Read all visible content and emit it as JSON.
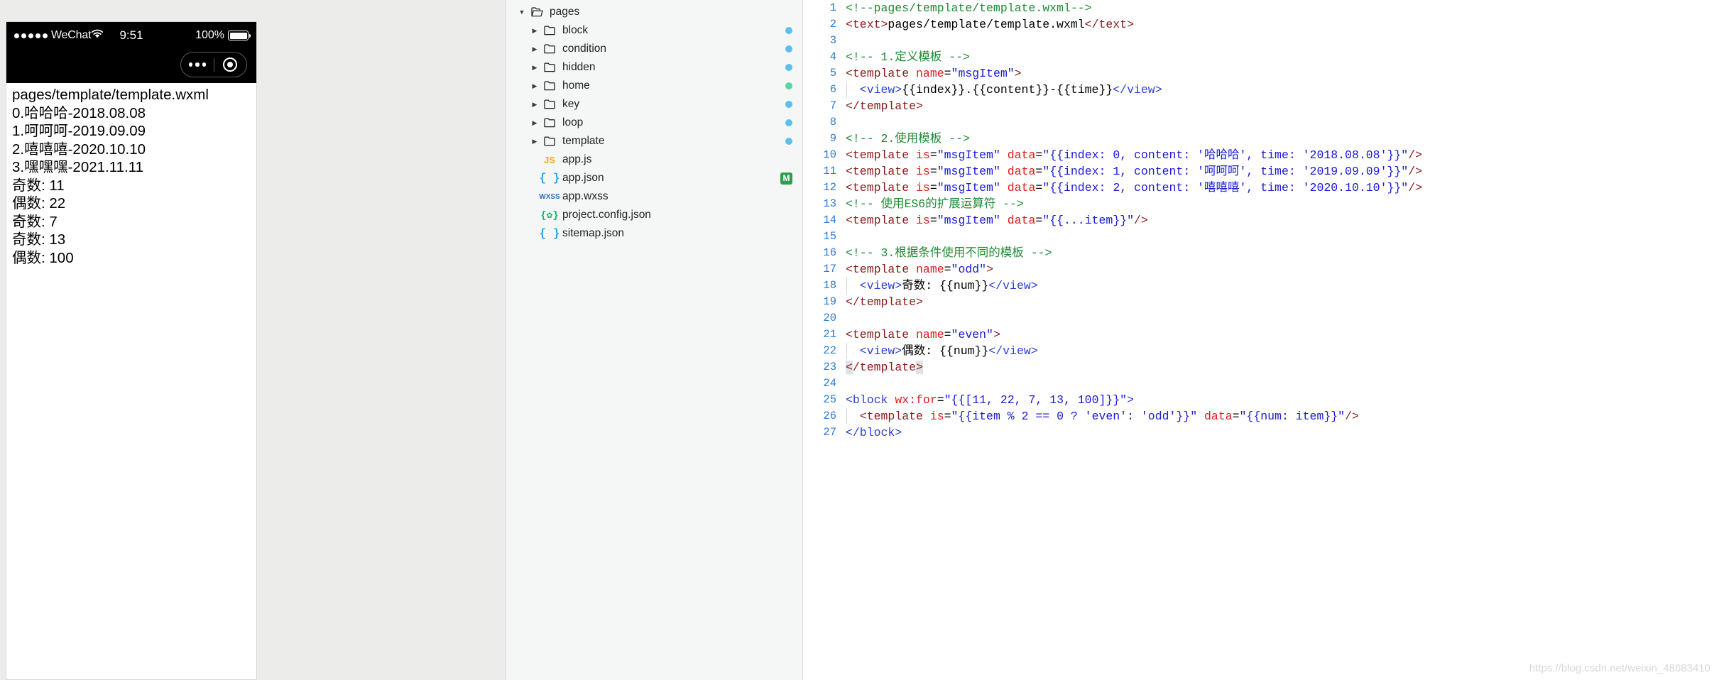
{
  "simulator": {
    "status_bar": {
      "signal_dots": 5,
      "carrier": "WeChat",
      "wifi_icon": "wifi-icon",
      "time": "9:51",
      "battery_percent": "100%",
      "battery_icon": "battery-full-icon"
    },
    "nav_capsule": {
      "menu_icon": "more-dots-icon",
      "target_icon": "target-circle-icon"
    },
    "page_lines": [
      "pages/template/template.wxml",
      "0.哈哈哈-2018.08.08",
      "1.呵呵呵-2019.09.09",
      "2.嘻嘻嘻-2020.10.10",
      "3.嘿嘿嘿-2021.11.11",
      "奇数: 11",
      "偶数: 22",
      "奇数: 7",
      "奇数: 13",
      "偶数: 100"
    ]
  },
  "file_tree": {
    "items": [
      {
        "label": "pages",
        "type": "folder",
        "depth": 0,
        "expanded": true,
        "arrow": "▼",
        "icon": "folder-open-icon",
        "dot": null,
        "badge": null
      },
      {
        "label": "block",
        "type": "folder",
        "depth": 1,
        "expanded": false,
        "arrow": "▶",
        "icon": "folder-icon",
        "dot": "#5bc0f0",
        "badge": null
      },
      {
        "label": "condition",
        "type": "folder",
        "depth": 1,
        "expanded": false,
        "arrow": "▶",
        "icon": "folder-icon",
        "dot": "#5bc0f0",
        "badge": null
      },
      {
        "label": "hidden",
        "type": "folder",
        "depth": 1,
        "expanded": false,
        "arrow": "▶",
        "icon": "folder-icon",
        "dot": "#5bc0f0",
        "badge": null
      },
      {
        "label": "home",
        "type": "folder",
        "depth": 1,
        "expanded": false,
        "arrow": "▶",
        "icon": "folder-icon",
        "dot": "#57d6a0",
        "badge": null
      },
      {
        "label": "key",
        "type": "folder",
        "depth": 1,
        "expanded": false,
        "arrow": "▶",
        "icon": "folder-icon",
        "dot": "#5bc0f0",
        "badge": null
      },
      {
        "label": "loop",
        "type": "folder",
        "depth": 1,
        "expanded": false,
        "arrow": "▶",
        "icon": "folder-icon",
        "dot": "#5bc0f0",
        "badge": null
      },
      {
        "label": "template",
        "type": "folder",
        "depth": 1,
        "expanded": false,
        "arrow": "▶",
        "icon": "folder-icon",
        "dot": "#5bc0f0",
        "badge": null
      },
      {
        "label": "app.js",
        "type": "file",
        "depth": 1,
        "expanded": null,
        "arrow": "",
        "icon": "js-file-icon",
        "dot": null,
        "badge": null,
        "ext_label": "JS",
        "ext_class": "ext-js"
      },
      {
        "label": "app.json",
        "type": "file",
        "depth": 1,
        "expanded": null,
        "arrow": "",
        "icon": "json-file-icon",
        "dot": null,
        "badge": "M",
        "ext_label": "{ }",
        "ext_class": "ext-json"
      },
      {
        "label": "app.wxss",
        "type": "file",
        "depth": 1,
        "expanded": null,
        "arrow": "",
        "icon": "wxss-file-icon",
        "dot": null,
        "badge": null,
        "ext_label": "WXSS",
        "ext_class": "ext-wxss"
      },
      {
        "label": "project.config.json",
        "type": "file",
        "depth": 1,
        "expanded": null,
        "arrow": "",
        "icon": "config-file-icon",
        "dot": null,
        "badge": null,
        "ext_label": "{✿}",
        "ext_class": "ext-cfg"
      },
      {
        "label": "sitemap.json",
        "type": "file",
        "depth": 1,
        "expanded": null,
        "arrow": "",
        "icon": "json-file-icon",
        "dot": null,
        "badge": null,
        "ext_label": "{ }",
        "ext_class": "ext-json"
      }
    ]
  },
  "editor": {
    "language": "wxml",
    "first_line_number": 1,
    "lines": [
      {
        "n": 1,
        "indent": false,
        "tokens": [
          {
            "t": "<!--pages/template/template.wxml-->",
            "c": "c-comment"
          }
        ]
      },
      {
        "n": 2,
        "indent": false,
        "tokens": [
          {
            "t": "<text>",
            "c": "c-tag"
          },
          {
            "t": "pages/template/template.wxml",
            "c": "c-plain"
          },
          {
            "t": "</text>",
            "c": "c-tag"
          }
        ]
      },
      {
        "n": 3,
        "indent": false,
        "tokens": []
      },
      {
        "n": 4,
        "indent": false,
        "tokens": [
          {
            "t": "<!-- 1.定义模板 -->",
            "c": "c-comment"
          }
        ]
      },
      {
        "n": 5,
        "indent": false,
        "tokens": [
          {
            "t": "<template ",
            "c": "c-tag"
          },
          {
            "t": "name",
            "c": "c-attr"
          },
          {
            "t": "=",
            "c": "c-plain"
          },
          {
            "t": "\"msgItem\"",
            "c": "c-str"
          },
          {
            "t": ">",
            "c": "c-tag"
          }
        ]
      },
      {
        "n": 6,
        "indent": true,
        "tokens": [
          {
            "t": "  <view>",
            "c": "c-tag2"
          },
          {
            "t": "{{index}}.{{content}}-{{time}}",
            "c": "c-plain"
          },
          {
            "t": "</view>",
            "c": "c-tag2"
          }
        ]
      },
      {
        "n": 7,
        "indent": false,
        "tokens": [
          {
            "t": "</template>",
            "c": "c-tag"
          }
        ]
      },
      {
        "n": 8,
        "indent": false,
        "tokens": []
      },
      {
        "n": 9,
        "indent": false,
        "tokens": [
          {
            "t": "<!-- 2.使用模板 -->",
            "c": "c-comment"
          }
        ]
      },
      {
        "n": 10,
        "indent": false,
        "tokens": [
          {
            "t": "<template ",
            "c": "c-tag"
          },
          {
            "t": "is",
            "c": "c-attr"
          },
          {
            "t": "=",
            "c": "c-plain"
          },
          {
            "t": "\"msgItem\"",
            "c": "c-str"
          },
          {
            "t": " ",
            "c": "c-plain"
          },
          {
            "t": "data",
            "c": "c-attr"
          },
          {
            "t": "=",
            "c": "c-plain"
          },
          {
            "t": "\"{{index: 0, content: '哈哈哈', time: '2018.08.08'}}\"",
            "c": "c-str"
          },
          {
            "t": "/>",
            "c": "c-tag"
          }
        ]
      },
      {
        "n": 11,
        "indent": false,
        "tokens": [
          {
            "t": "<template ",
            "c": "c-tag"
          },
          {
            "t": "is",
            "c": "c-attr"
          },
          {
            "t": "=",
            "c": "c-plain"
          },
          {
            "t": "\"msgItem\"",
            "c": "c-str"
          },
          {
            "t": " ",
            "c": "c-plain"
          },
          {
            "t": "data",
            "c": "c-attr"
          },
          {
            "t": "=",
            "c": "c-plain"
          },
          {
            "t": "\"{{index: 1, content: '呵呵呵', time: '2019.09.09'}}\"",
            "c": "c-str"
          },
          {
            "t": "/>",
            "c": "c-tag"
          }
        ]
      },
      {
        "n": 12,
        "indent": false,
        "tokens": [
          {
            "t": "<template ",
            "c": "c-tag"
          },
          {
            "t": "is",
            "c": "c-attr"
          },
          {
            "t": "=",
            "c": "c-plain"
          },
          {
            "t": "\"msgItem\"",
            "c": "c-str"
          },
          {
            "t": " ",
            "c": "c-plain"
          },
          {
            "t": "data",
            "c": "c-attr"
          },
          {
            "t": "=",
            "c": "c-plain"
          },
          {
            "t": "\"{{index: 2, content: '嘻嘻嘻', time: '2020.10.10'}}\"",
            "c": "c-str"
          },
          {
            "t": "/>",
            "c": "c-tag"
          }
        ]
      },
      {
        "n": 13,
        "indent": false,
        "tokens": [
          {
            "t": "<!-- 使用ES6的扩展运算符 -->",
            "c": "c-comment"
          }
        ]
      },
      {
        "n": 14,
        "indent": false,
        "tokens": [
          {
            "t": "<template ",
            "c": "c-tag"
          },
          {
            "t": "is",
            "c": "c-attr"
          },
          {
            "t": "=",
            "c": "c-plain"
          },
          {
            "t": "\"msgItem\"",
            "c": "c-str"
          },
          {
            "t": " ",
            "c": "c-plain"
          },
          {
            "t": "data",
            "c": "c-attr"
          },
          {
            "t": "=",
            "c": "c-plain"
          },
          {
            "t": "\"{{...item}}\"",
            "c": "c-str"
          },
          {
            "t": "/>",
            "c": "c-tag"
          }
        ]
      },
      {
        "n": 15,
        "indent": false,
        "tokens": []
      },
      {
        "n": 16,
        "indent": false,
        "tokens": [
          {
            "t": "<!-- 3.根据条件使用不同的模板 -->",
            "c": "c-comment"
          }
        ]
      },
      {
        "n": 17,
        "indent": false,
        "tokens": [
          {
            "t": "<template ",
            "c": "c-tag"
          },
          {
            "t": "name",
            "c": "c-attr"
          },
          {
            "t": "=",
            "c": "c-plain"
          },
          {
            "t": "\"odd\"",
            "c": "c-str"
          },
          {
            "t": ">",
            "c": "c-tag"
          }
        ]
      },
      {
        "n": 18,
        "indent": true,
        "tokens": [
          {
            "t": "  <view>",
            "c": "c-tag2"
          },
          {
            "t": "奇数: {{num}}",
            "c": "c-plain"
          },
          {
            "t": "</view>",
            "c": "c-tag2"
          }
        ]
      },
      {
        "n": 19,
        "indent": false,
        "tokens": [
          {
            "t": "</template>",
            "c": "c-tag"
          }
        ]
      },
      {
        "n": 20,
        "indent": false,
        "tokens": []
      },
      {
        "n": 21,
        "indent": false,
        "tokens": [
          {
            "t": "<template ",
            "c": "c-tag"
          },
          {
            "t": "name",
            "c": "c-attr"
          },
          {
            "t": "=",
            "c": "c-plain"
          },
          {
            "t": "\"even\"",
            "c": "c-str"
          },
          {
            "t": ">",
            "c": "c-tag"
          }
        ]
      },
      {
        "n": 22,
        "indent": true,
        "tokens": [
          {
            "t": "  <view>",
            "c": "c-tag2"
          },
          {
            "t": "偶数: {{num}}",
            "c": "c-plain"
          },
          {
            "t": "</view>",
            "c": "c-tag2"
          }
        ]
      },
      {
        "n": 23,
        "indent": false,
        "tokens": [
          {
            "t": "<",
            "c": "c-tag hl"
          },
          {
            "t": "/template",
            "c": "c-tag"
          },
          {
            "t": ">",
            "c": "c-tag hl"
          }
        ]
      },
      {
        "n": 24,
        "indent": false,
        "tokens": []
      },
      {
        "n": 25,
        "indent": false,
        "tokens": [
          {
            "t": "<block ",
            "c": "c-tag2"
          },
          {
            "t": "wx:for",
            "c": "c-attr"
          },
          {
            "t": "=",
            "c": "c-plain"
          },
          {
            "t": "\"{{[11, 22, 7, 13, 100]}}\"",
            "c": "c-str"
          },
          {
            "t": ">",
            "c": "c-tag2"
          }
        ]
      },
      {
        "n": 26,
        "indent": true,
        "tokens": [
          {
            "t": "  <template ",
            "c": "c-tag"
          },
          {
            "t": "is",
            "c": "c-attr"
          },
          {
            "t": "=",
            "c": "c-plain"
          },
          {
            "t": "\"{{item % 2 == 0 ? 'even': 'odd'}}\"",
            "c": "c-str"
          },
          {
            "t": " ",
            "c": "c-plain"
          },
          {
            "t": "data",
            "c": "c-attr"
          },
          {
            "t": "=",
            "c": "c-plain"
          },
          {
            "t": "\"{{num: item}}\"",
            "c": "c-str"
          },
          {
            "t": "/>",
            "c": "c-tag"
          }
        ]
      },
      {
        "n": 27,
        "indent": false,
        "tokens": [
          {
            "t": "</block>",
            "c": "c-tag2"
          }
        ]
      }
    ],
    "watermark": "https://blog.csdn.net/weixin_48683410"
  }
}
